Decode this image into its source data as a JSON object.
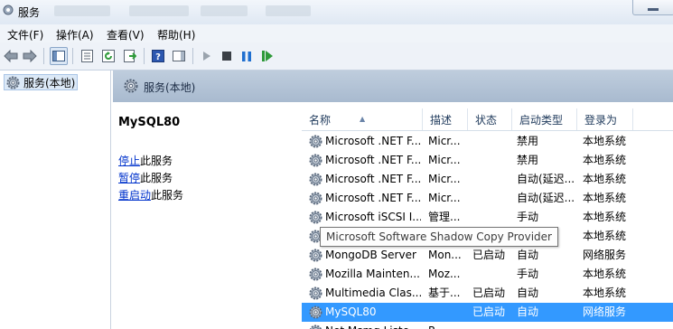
{
  "window": {
    "title": "服务"
  },
  "menu": [
    "文件(F)",
    "操作(A)",
    "查看(V)",
    "帮助(H)"
  ],
  "tree": {
    "item": "服务(本地)"
  },
  "pane": {
    "header": "服务(本地)",
    "service_name": "MySQL80",
    "actions": [
      {
        "link": "停止",
        "rest": "此服务"
      },
      {
        "link": "暂停",
        "rest": "此服务"
      },
      {
        "link": "重启动",
        "rest": "此服务"
      }
    ]
  },
  "columns": [
    "名称",
    "描述",
    "状态",
    "启动类型",
    "登录为"
  ],
  "rows": [
    {
      "name": "Microsoft .NET F...",
      "desc": "Micr...",
      "status": "",
      "startup": "禁用",
      "logon": "本地系统"
    },
    {
      "name": "Microsoft .NET F...",
      "desc": "Micr...",
      "status": "",
      "startup": "禁用",
      "logon": "本地系统"
    },
    {
      "name": "Microsoft .NET F...",
      "desc": "Micr...",
      "status": "",
      "startup": "自动(延迟...",
      "logon": "本地系统"
    },
    {
      "name": "Microsoft .NET F...",
      "desc": "Micr...",
      "status": "",
      "startup": "自动(延迟...",
      "logon": "本地系统"
    },
    {
      "name": "Microsoft iSCSI I...",
      "desc": "管理...",
      "status": "",
      "startup": "手动",
      "logon": "本地系统"
    },
    {
      "name": "",
      "desc": "",
      "status": "",
      "startup": "",
      "logon": "本地系统"
    },
    {
      "name": "MongoDB Server",
      "desc": "Mon...",
      "status": "已启动",
      "startup": "自动",
      "logon": "网络服务"
    },
    {
      "name": "Mozilla Mainten...",
      "desc": "Moz...",
      "status": "",
      "startup": "手动",
      "logon": "本地系统"
    },
    {
      "name": "Multimedia Clas...",
      "desc": "基于...",
      "status": "已启动",
      "startup": "自动",
      "logon": "本地系统"
    },
    {
      "name": "MySQL80",
      "desc": "",
      "status": "已启动",
      "startup": "自动",
      "logon": "网络服务"
    },
    {
      "name": "Net.Msmq Liste...",
      "desc": "R...",
      "status": "",
      "startup": "",
      "logon": ""
    }
  ],
  "selected_row": 9,
  "tooltip": "Microsoft Software Shadow Copy Provider",
  "colors": {
    "selection": "#3399ff",
    "link": "#0033cc",
    "header_band": "#b4c4d7"
  }
}
